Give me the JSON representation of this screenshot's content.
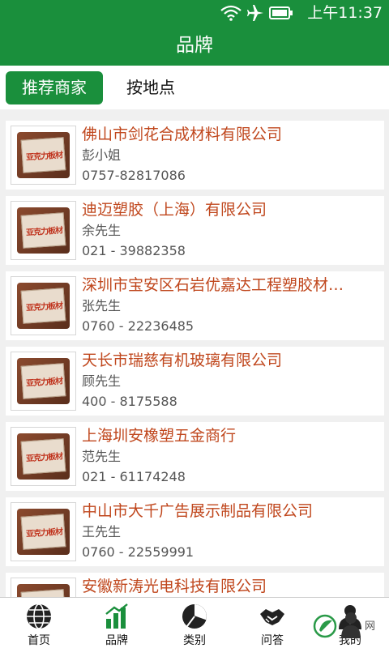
{
  "status_bar": {
    "time": "上午11:37"
  },
  "header": {
    "title": "品牌"
  },
  "tabs": [
    {
      "label": "推荐商家",
      "active": true
    },
    {
      "label": "按地点",
      "active": false
    }
  ],
  "logo_text": "亚克力板材",
  "merchants": [
    {
      "name": "佛山市剑花合成材料有限公司",
      "contact": "彭小姐",
      "phone": "0757-82817086"
    },
    {
      "name": "迪迈塑胶（上海）有限公司",
      "contact": "余先生",
      "phone": "021 - 39882358"
    },
    {
      "name": "深圳市宝安区石岩优嘉达工程塑胶材…",
      "contact": "张先生",
      "phone": "0760 - 22236485"
    },
    {
      "name": "天长市瑞慈有机玻璃有限公司",
      "contact": "顾先生",
      "phone": "400 - 8175588"
    },
    {
      "name": "上海圳安橡塑五金商行",
      "contact": "范先生",
      "phone": "021 - 61174248"
    },
    {
      "name": "中山市大千广告展示制品有限公司",
      "contact": "王先生",
      "phone": "0760 - 22559991"
    },
    {
      "name": "安徽新涛光电科技有限公司",
      "contact": "",
      "phone": ""
    }
  ],
  "nav": [
    {
      "label": "首页",
      "icon": "globe-icon"
    },
    {
      "label": "品牌",
      "icon": "bar-chart-icon"
    },
    {
      "label": "类别",
      "icon": "pie-chart-icon"
    },
    {
      "label": "问答",
      "icon": "handshake-icon"
    },
    {
      "label": "我的",
      "icon": "user-icon"
    }
  ],
  "watermark": "网",
  "colors": {
    "primary": "#1a8f3c",
    "merchant_name": "#c0471d",
    "text_secondary": "#555555"
  }
}
